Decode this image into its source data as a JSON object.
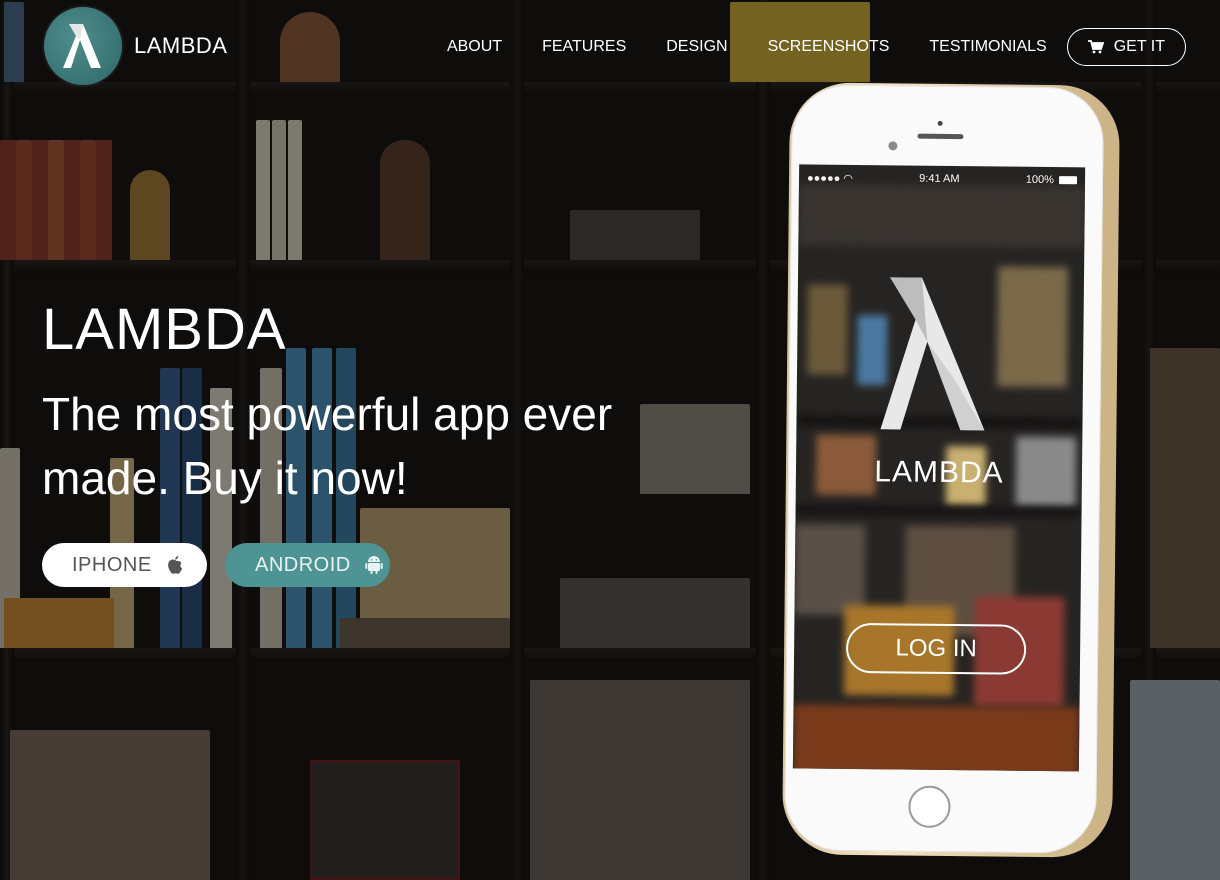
{
  "brand": {
    "name": "LAMBDA",
    "logo_icon": "lambda-icon",
    "accent": "#4f9494"
  },
  "nav": {
    "links": [
      "ABOUT",
      "FEATURES",
      "DESIGN",
      "SCREENSHOTS",
      "TESTIMONIALS"
    ],
    "cta_label": "GET IT",
    "cta_icon": "shopping-cart-icon"
  },
  "hero": {
    "title": "LAMBDA",
    "subtitle": "The most powerful app ever made. Buy it now!",
    "buttons": [
      {
        "label": "IPHONE",
        "icon": "apple-icon",
        "bg": "#ffffff",
        "color": "#555555"
      },
      {
        "label": "ANDROID",
        "icon": "android-icon",
        "bg": "#4f9494",
        "color": "#e9f3f3"
      }
    ]
  },
  "phone": {
    "time": "9:41 AM",
    "battery": "100%",
    "app_name": "LAMBDA",
    "login_label": "LOG IN"
  }
}
